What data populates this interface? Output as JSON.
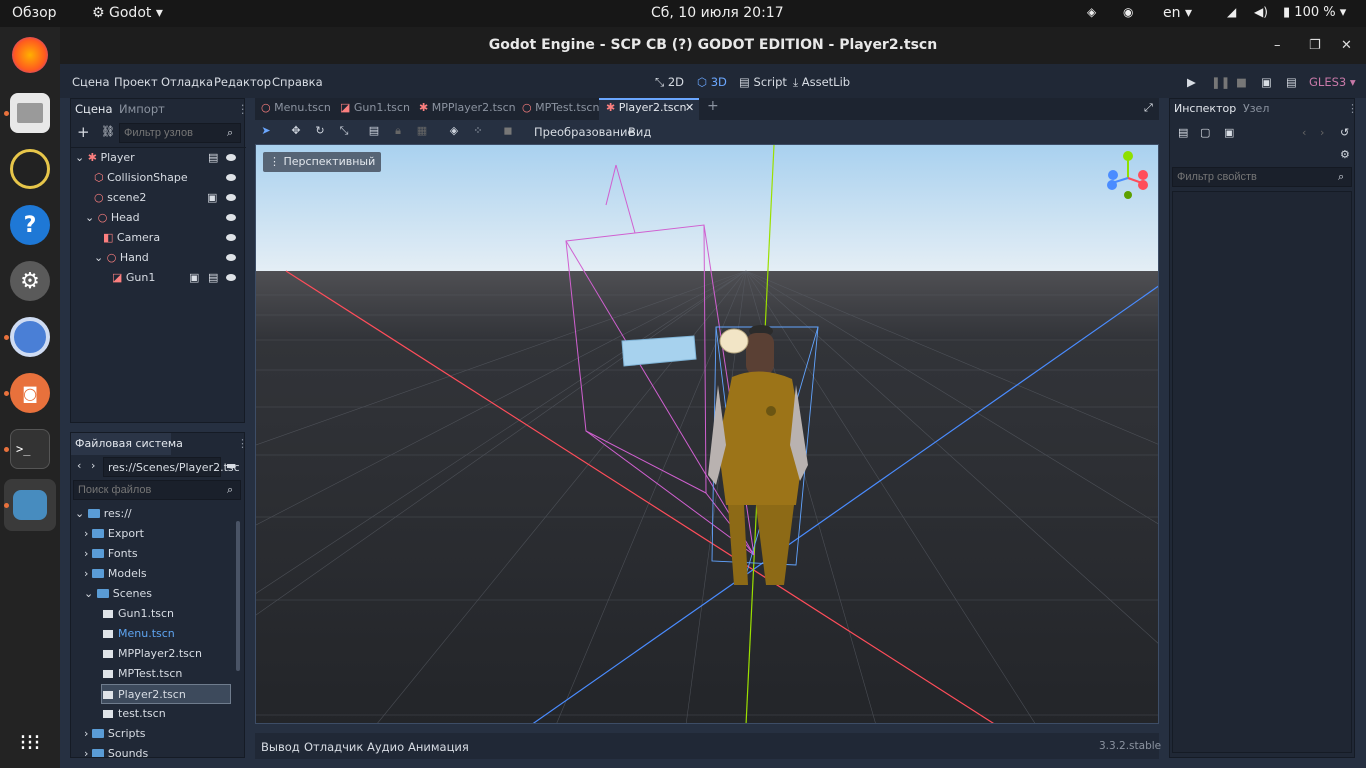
{
  "topbar": {
    "overview": "Обзор",
    "app": "Godot",
    "datetime": "Сб, 10 июля  20:17",
    "lang": "en",
    "battery": "100 %"
  },
  "window": {
    "title": "Godot Engine - SCP CB (?) GODOT EDITION - Player2.tscn"
  },
  "menu": {
    "items": [
      "Сцена",
      "Проект",
      "Отладка",
      "Редактор",
      "Справка"
    ]
  },
  "workspaces": {
    "2d": "2D",
    "3d": "3D",
    "script": "Script",
    "assetlib": "AssetLib"
  },
  "renderer": "GLES3",
  "scene_dock": {
    "tabs": [
      "Сцена",
      "Импорт"
    ],
    "filter_placeholder": "Фильтр узлов",
    "nodes": [
      {
        "name": "Player",
        "type": "spatial"
      },
      {
        "name": "CollisionShape",
        "type": "collision"
      },
      {
        "name": "scene2",
        "type": "instance"
      },
      {
        "name": "Head",
        "type": "spatial"
      },
      {
        "name": "Camera",
        "type": "camera"
      },
      {
        "name": "Hand",
        "type": "spatial"
      },
      {
        "name": "Gun1",
        "type": "mesh"
      }
    ]
  },
  "filesystem": {
    "title": "Файловая система",
    "path": "res://Scenes/Player2.tsc",
    "search_placeholder": "Поиск файлов",
    "items": [
      {
        "name": "res://",
        "kind": "folder"
      },
      {
        "name": "Export",
        "kind": "folder"
      },
      {
        "name": "Fonts",
        "kind": "folder"
      },
      {
        "name": "Models",
        "kind": "folder"
      },
      {
        "name": "Scenes",
        "kind": "folder"
      },
      {
        "name": "Gun1.tscn",
        "kind": "scene"
      },
      {
        "name": "Menu.tscn",
        "kind": "scene",
        "color": "#5ea4f0"
      },
      {
        "name": "MPPlayer2.tscn",
        "kind": "scene"
      },
      {
        "name": "MPTest.tscn",
        "kind": "scene"
      },
      {
        "name": "Player2.tscn",
        "kind": "scene",
        "selected": true
      },
      {
        "name": "test.tscn",
        "kind": "scene"
      },
      {
        "name": "Scripts",
        "kind": "folder"
      },
      {
        "name": "Sounds",
        "kind": "folder"
      }
    ]
  },
  "scene_tabs": [
    "Menu.tscn",
    "Gun1.tscn",
    "MPPlayer2.tscn",
    "MPTest.tscn",
    "Player2.tscn"
  ],
  "toolbar": {
    "transform": "Преобразование",
    "view": "Вид"
  },
  "viewport": {
    "mode": "Перспективный"
  },
  "inspector": {
    "tabs": [
      "Инспектор",
      "Узел"
    ],
    "filter_placeholder": "Фильтр свойств"
  },
  "bottom": {
    "items": [
      "Вывод",
      "Отладчик",
      "Аудио",
      "Анимация"
    ],
    "version": "3.3.2.stable"
  },
  "colors": {
    "accent": "#6ba7ff",
    "selected": "#4b5b6e",
    "x_axis": "#ff4d5a",
    "z_axis": "#4a8cff",
    "y_axis": "#9be000"
  }
}
